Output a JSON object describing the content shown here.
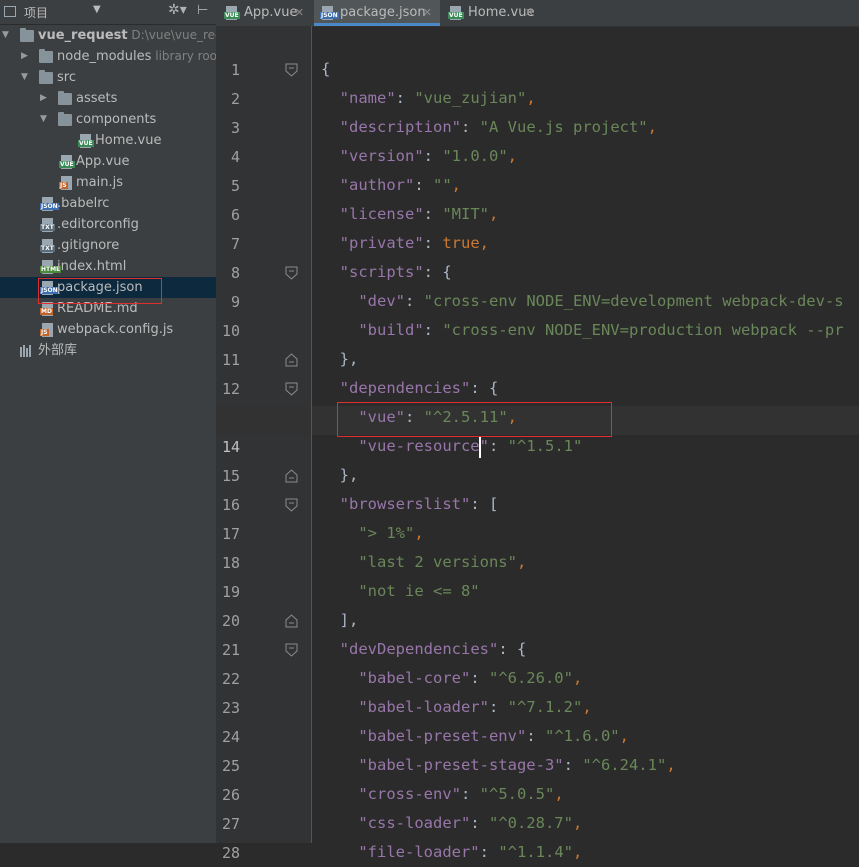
{
  "project_panel": {
    "header_title": "项目",
    "tree": [
      {
        "label": "vue_request",
        "hint": "D:\\vue\\vue_reque",
        "kind": "folder",
        "depth": 0,
        "expanded": true
      },
      {
        "label": "node_modules",
        "hint": "library root",
        "kind": "folder",
        "depth": 1,
        "expanded": false
      },
      {
        "label": "src",
        "kind": "folder",
        "depth": 1,
        "expanded": true
      },
      {
        "label": "assets",
        "kind": "folder",
        "depth": 2,
        "expanded": false
      },
      {
        "label": "components",
        "kind": "folder",
        "depth": 2,
        "expanded": true
      },
      {
        "label": "Home.vue",
        "kind": "vue",
        "depth": 3
      },
      {
        "label": "App.vue",
        "kind": "vue",
        "depth": 2
      },
      {
        "label": "main.js",
        "kind": "js",
        "depth": 2
      },
      {
        "label": ".babelrc",
        "kind": "json",
        "depth": 1
      },
      {
        "label": ".editorconfig",
        "kind": "txt",
        "depth": 1
      },
      {
        "label": ".gitignore",
        "kind": "txt",
        "depth": 1
      },
      {
        "label": "index.html",
        "kind": "html",
        "depth": 1
      },
      {
        "label": "package.json",
        "kind": "json",
        "depth": 1,
        "selected": true
      },
      {
        "label": "README.md",
        "kind": "md",
        "depth": 1
      },
      {
        "label": "webpack.config.js",
        "kind": "js",
        "depth": 1
      },
      {
        "label": "外部库",
        "kind": "lib",
        "depth": 0
      }
    ]
  },
  "tabs": [
    {
      "label": "App.vue",
      "kind": "vue",
      "active": false
    },
    {
      "label": "package.json",
      "kind": "json",
      "active": true
    },
    {
      "label": "Home.vue",
      "kind": "vue",
      "active": false
    }
  ],
  "icon_tags": {
    "vue": "VUE",
    "js": "JS",
    "json": "JSON",
    "html": "HTML",
    "md": "MD",
    "txt": "TXT"
  },
  "editor": {
    "current_line": 14,
    "lines": [
      [
        {
          "t": "{",
          "c": "plain"
        }
      ],
      [
        {
          "t": "  "
        },
        {
          "t": "\"name\"",
          "c": "k"
        },
        {
          "t": ": "
        },
        {
          "t": "\"vue_zujian\"",
          "c": "s"
        },
        {
          "t": ",",
          "c": "p"
        }
      ],
      [
        {
          "t": "  "
        },
        {
          "t": "\"description\"",
          "c": "k"
        },
        {
          "t": ": "
        },
        {
          "t": "\"A Vue.js project\"",
          "c": "s"
        },
        {
          "t": ",",
          "c": "p"
        }
      ],
      [
        {
          "t": "  "
        },
        {
          "t": "\"version\"",
          "c": "k"
        },
        {
          "t": ": "
        },
        {
          "t": "\"1.0.0\"",
          "c": "s"
        },
        {
          "t": ",",
          "c": "p"
        }
      ],
      [
        {
          "t": "  "
        },
        {
          "t": "\"author\"",
          "c": "k"
        },
        {
          "t": ": "
        },
        {
          "t": "\"\"",
          "c": "s"
        },
        {
          "t": ",",
          "c": "p"
        }
      ],
      [
        {
          "t": "  "
        },
        {
          "t": "\"license\"",
          "c": "k"
        },
        {
          "t": ": "
        },
        {
          "t": "\"MIT\"",
          "c": "s"
        },
        {
          "t": ",",
          "c": "p"
        }
      ],
      [
        {
          "t": "  "
        },
        {
          "t": "\"private\"",
          "c": "k"
        },
        {
          "t": ": "
        },
        {
          "t": "true",
          "c": "kw"
        },
        {
          "t": ",",
          "c": "p"
        }
      ],
      [
        {
          "t": "  "
        },
        {
          "t": "\"scripts\"",
          "c": "k"
        },
        {
          "t": ": {"
        }
      ],
      [
        {
          "t": "    "
        },
        {
          "t": "\"dev\"",
          "c": "k"
        },
        {
          "t": ": "
        },
        {
          "t": "\"cross-env NODE_ENV=development webpack-dev-s",
          "c": "s"
        }
      ],
      [
        {
          "t": "    "
        },
        {
          "t": "\"build\"",
          "c": "k"
        },
        {
          "t": ": "
        },
        {
          "t": "\"cross-env NODE_ENV=production webpack --pr",
          "c": "s"
        }
      ],
      [
        {
          "t": "  },"
        }
      ],
      [
        {
          "t": "  "
        },
        {
          "t": "\"dependencies\"",
          "c": "k"
        },
        {
          "t": ": {"
        }
      ],
      [
        {
          "t": "    "
        },
        {
          "t": "\"vue\"",
          "c": "k"
        },
        {
          "t": ": "
        },
        {
          "t": "\"^2.5.11\"",
          "c": "s"
        },
        {
          "t": ",",
          "c": "p"
        }
      ],
      [
        {
          "t": "    "
        },
        {
          "t": "\"vue-resource",
          "c": "k"
        },
        {
          "t": "|",
          "c": "caret"
        },
        {
          "t": "\"",
          "c": "k"
        },
        {
          "t": ": "
        },
        {
          "t": "\"^1.5.1\"",
          "c": "s"
        }
      ],
      [
        {
          "t": "  },"
        }
      ],
      [
        {
          "t": "  "
        },
        {
          "t": "\"browserslist\"",
          "c": "k"
        },
        {
          "t": ": ["
        }
      ],
      [
        {
          "t": "    "
        },
        {
          "t": "\"> 1%\"",
          "c": "s"
        },
        {
          "t": ",",
          "c": "p"
        }
      ],
      [
        {
          "t": "    "
        },
        {
          "t": "\"last 2 versions\"",
          "c": "s"
        },
        {
          "t": ",",
          "c": "p"
        }
      ],
      [
        {
          "t": "    "
        },
        {
          "t": "\"not ie <= 8\"",
          "c": "s"
        }
      ],
      [
        {
          "t": "  ],"
        }
      ],
      [
        {
          "t": "  "
        },
        {
          "t": "\"devDependencies\"",
          "c": "k"
        },
        {
          "t": ": {"
        }
      ],
      [
        {
          "t": "    "
        },
        {
          "t": "\"babel-core\"",
          "c": "k"
        },
        {
          "t": ": "
        },
        {
          "t": "\"^6.26.0\"",
          "c": "s"
        },
        {
          "t": ",",
          "c": "p"
        }
      ],
      [
        {
          "t": "    "
        },
        {
          "t": "\"babel-loader\"",
          "c": "k"
        },
        {
          "t": ": "
        },
        {
          "t": "\"^7.1.2\"",
          "c": "s"
        },
        {
          "t": ",",
          "c": "p"
        }
      ],
      [
        {
          "t": "    "
        },
        {
          "t": "\"babel-preset-env\"",
          "c": "k"
        },
        {
          "t": ": "
        },
        {
          "t": "\"^1.6.0\"",
          "c": "s"
        },
        {
          "t": ",",
          "c": "p"
        }
      ],
      [
        {
          "t": "    "
        },
        {
          "t": "\"babel-preset-stage-3\"",
          "c": "k"
        },
        {
          "t": ": "
        },
        {
          "t": "\"^6.24.1\"",
          "c": "s"
        },
        {
          "t": ",",
          "c": "p"
        }
      ],
      [
        {
          "t": "    "
        },
        {
          "t": "\"cross-env\"",
          "c": "k"
        },
        {
          "t": ": "
        },
        {
          "t": "\"^5.0.5\"",
          "c": "s"
        },
        {
          "t": ",",
          "c": "p"
        }
      ],
      [
        {
          "t": "    "
        },
        {
          "t": "\"css-loader\"",
          "c": "k"
        },
        {
          "t": ": "
        },
        {
          "t": "\"^0.28.7\"",
          "c": "s"
        },
        {
          "t": ",",
          "c": "p"
        }
      ],
      [
        {
          "t": "    "
        },
        {
          "t": "\"file-loader\"",
          "c": "k"
        },
        {
          "t": ": "
        },
        {
          "t": "\"^1.1.4\"",
          "c": "s"
        },
        {
          "t": ",",
          "c": "p"
        }
      ]
    ],
    "fold_open_lines": [
      1,
      8,
      12,
      16,
      21
    ],
    "fold_close_lines": [
      11,
      15,
      20
    ]
  },
  "colors": {
    "key": "#9876aa",
    "string": "#6a8759",
    "keyword": "#cc7832",
    "panel_bg": "#3c3f41",
    "editor_bg": "#2b2b2b",
    "selection": "#0d293e",
    "highlight_border": "#e02d2d"
  }
}
